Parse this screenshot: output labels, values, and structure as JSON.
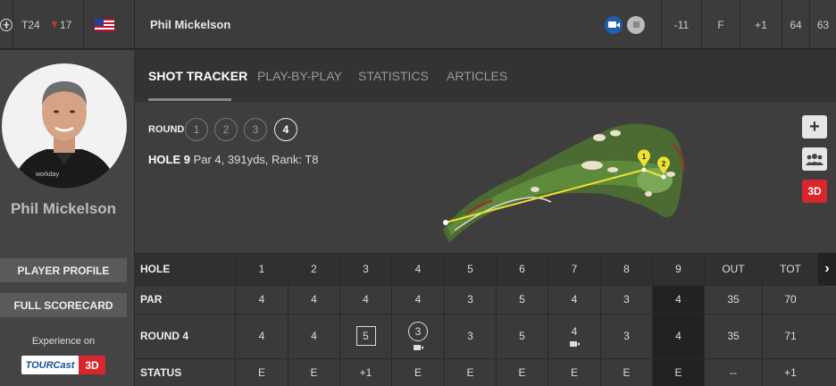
{
  "topbar": {
    "position": "T24",
    "movement": "17",
    "player_name": "Phil Mickelson",
    "stats": [
      "-11",
      "F",
      "+1",
      "64",
      "63"
    ]
  },
  "sidebar": {
    "player_name": "Phil Mickelson",
    "profile_button": "PLAYER PROFILE",
    "scorecard_button": "FULL SCORECARD",
    "experience_text": "Experience on",
    "tourcast_label": "TOURCast",
    "tourcast_3d": "3D"
  },
  "tabs": [
    {
      "label": "SHOT TRACKER",
      "active": true
    },
    {
      "label": "PLAY-BY-PLAY",
      "active": false
    },
    {
      "label": "STATISTICS",
      "active": false
    },
    {
      "label": "ARTICLES",
      "active": false
    }
  ],
  "tracker": {
    "round_label": "ROUND",
    "rounds": [
      "1",
      "2",
      "3",
      "4"
    ],
    "active_round": "4",
    "hole_title": "HOLE 9",
    "hole_details": "Par 4, 391yds, Rank: T8",
    "shot_markers": [
      "1",
      "2"
    ],
    "tool_3d": "3D"
  },
  "scorecard": {
    "labels": {
      "hole": "HOLE",
      "par": "PAR",
      "round": "ROUND 4",
      "status": "STATUS"
    },
    "holes": [
      "1",
      "2",
      "3",
      "4",
      "5",
      "6",
      "7",
      "8",
      "9",
      "OUT",
      "TOT"
    ],
    "par": [
      "4",
      "4",
      "4",
      "4",
      "3",
      "5",
      "4",
      "3",
      "4",
      "35",
      "70"
    ],
    "round": [
      "4",
      "4",
      "5",
      "3",
      "3",
      "5",
      "4",
      "3",
      "4",
      "35",
      "71"
    ],
    "status": [
      "E",
      "E",
      "+1",
      "E",
      "E",
      "E",
      "E",
      "E",
      "E",
      "--",
      "+1"
    ]
  },
  "colors": {
    "accent_red": "#d9262c",
    "video_blue": "#1d5fa8",
    "shot_line": "#f0e130"
  }
}
